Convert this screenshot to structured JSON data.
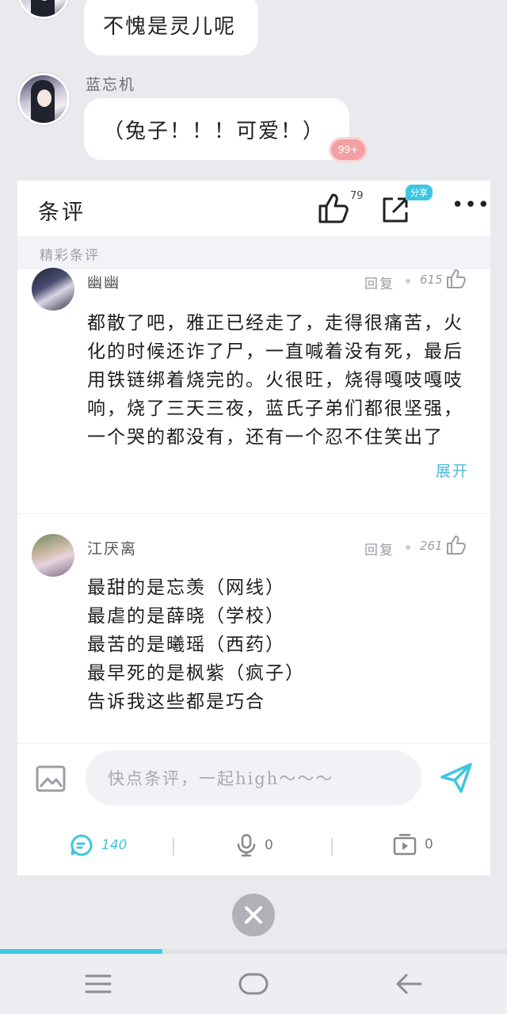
{
  "chat": {
    "messages": [
      {
        "sender": "",
        "text": "不愧是灵儿呢"
      },
      {
        "sender": "蓝忘机",
        "text": "（兔子！！！可爱！）",
        "badge": "99+"
      }
    ]
  },
  "panel": {
    "title": "条评",
    "like_count": "79",
    "share_label": "分享",
    "more_label": "•••",
    "section_label": "精彩条评",
    "comments": [
      {
        "user": "幽幽",
        "reply_label": "回复",
        "likes": "615",
        "lines": [
          "都散了吧，雅正已经走了，走得很痛苦，火",
          "化的时候还诈了尸，一直喊着没有死，最后",
          "用铁链绑着烧完的。火很旺，烧得嘎吱嘎吱",
          "响，烧了三天三夜，蓝氏子弟们都很坚强，",
          "一个哭的都没有，还有一个忍不住笑出了"
        ],
        "expand_label": "展开"
      },
      {
        "user": "江厌离",
        "reply_label": "回复",
        "likes": "261",
        "lines": [
          "最甜的是忘羡（网线）",
          "最虐的是薛晓（学校）",
          "最苦的是曦瑶（西药）",
          "最早死的是枫紫（疯子）",
          "告诉我这些都是巧合"
        ]
      }
    ],
    "input_placeholder": "快点条评，一起high～～～",
    "stats": {
      "comments": "140",
      "voice": "0",
      "video": "0"
    }
  },
  "progress": {
    "fraction": 0.32
  },
  "colors": {
    "accent": "#3ec6e0",
    "badge": "#f4a0a2",
    "background": "#e9eaee"
  },
  "icons": [
    "like-icon",
    "share-icon",
    "more-icon",
    "image-icon",
    "send-icon",
    "comment-icon",
    "microphone-icon",
    "video-icon",
    "close-icon",
    "menu-icon",
    "home-icon",
    "back-icon"
  ]
}
